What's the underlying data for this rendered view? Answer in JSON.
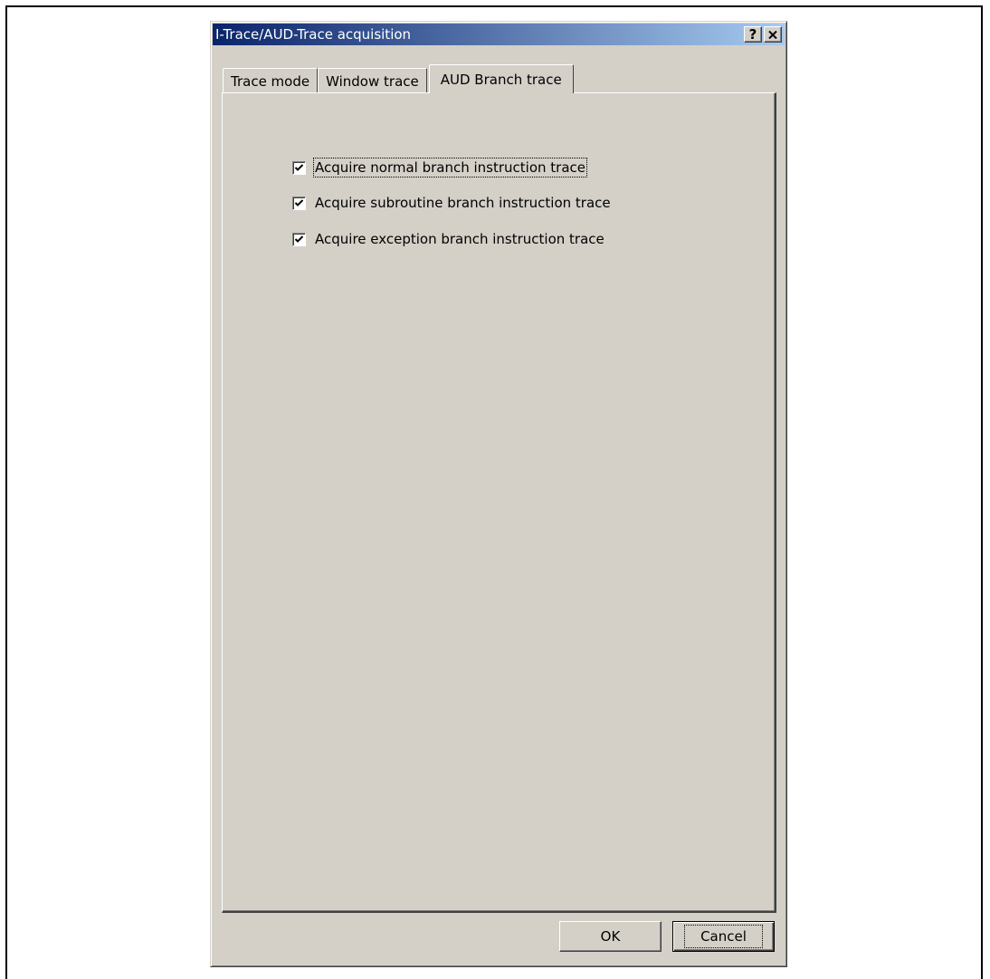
{
  "dialog": {
    "title": "I-Trace/AUD-Trace acquisition",
    "help_button": "?",
    "close_button": "✕"
  },
  "tabs": [
    {
      "label": "Trace mode",
      "active": false
    },
    {
      "label": "Window trace",
      "active": false
    },
    {
      "label": "AUD Branch trace",
      "active": true
    }
  ],
  "options": [
    {
      "label": "Acquire normal branch instruction trace",
      "checked": true
    },
    {
      "label": "Acquire subroutine branch instruction trace",
      "checked": true
    },
    {
      "label": "Acquire exception branch instruction trace",
      "checked": true
    }
  ],
  "buttons": {
    "ok": "OK",
    "cancel": "Cancel"
  }
}
